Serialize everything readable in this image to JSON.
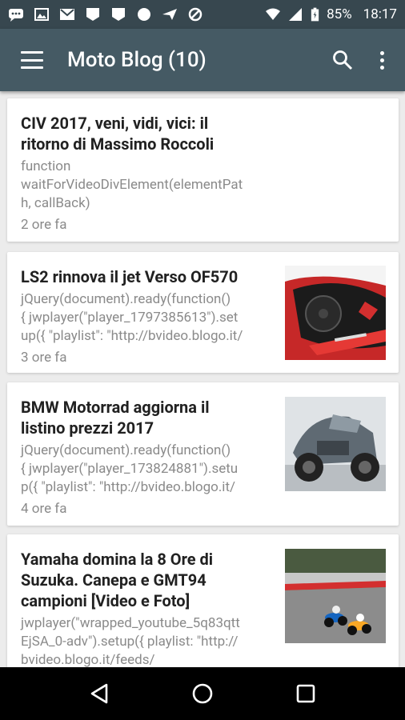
{
  "status_bar": {
    "battery": "85%",
    "time": "18:17",
    "left_icons": [
      "chat-icon",
      "image-icon",
      "gmail-icon",
      "shield-icon",
      "shield-icon",
      "circle-icon",
      "send-icon",
      "blocked-icon"
    ],
    "right_icons": [
      "wifi-icon",
      "signal-icon",
      "battery-icon"
    ]
  },
  "app_bar": {
    "title": "Moto Blog (10)",
    "menu_icon": "hamburger-menu-icon",
    "search_icon": "search-icon",
    "more_icon": "more-vert-icon"
  },
  "posts": [
    {
      "title_l1": "CIV 2017, veni, vidi, vici: il",
      "title_l2": "ritorno di Massimo Roccoli",
      "snippet_l1": "function",
      "snippet_l2": "waitForVideoDivElement(elementPat",
      "snippet_l3": "h, callBack)",
      "time": "2 ore fa",
      "has_thumb": false
    },
    {
      "title_l1": "LS2 rinnova il jet Verso OF570",
      "snippet_l1": "jQuery(document).ready(function()",
      "snippet_l2": "{ jwplayer(\"player_1797385613\").set",
      "snippet_l3": "up({ \"playlist\": \"http://bvideo.blogo.it/",
      "time": "3 ore fa",
      "thumb": "helmet-photo"
    },
    {
      "title_l1": "BMW Motorrad aggiorna il",
      "title_l2": "listino prezzi 2017",
      "snippet_l1": "jQuery(document).ready(function()",
      "snippet_l2": "{ jwplayer(\"player_173824881\").setu",
      "snippet_l3": "p({ \"playlist\": \"http://bvideo.blogo.it/",
      "time": "4 ore fa",
      "thumb": "bmw-motorcycle-photo"
    },
    {
      "title_l1": "Yamaha domina la 8 Ore di",
      "title_l2": "Suzuka. Canepa e GMT94",
      "title_l3": "campioni [Video e Foto]",
      "snippet_l1": "jwplayer(\"wrapped_youtube_5q83qtt",
      "snippet_l2": "EjSA_0-adv\").setup({ playlist: \"http://",
      "snippet_l3": "bvideo.blogo.it/feeds/",
      "thumb": "race-photo"
    }
  ],
  "nav_bar": {
    "back_icon": "back-triangle-icon",
    "home_icon": "home-circle-icon",
    "recents_icon": "recents-square-icon"
  },
  "colors": {
    "status_bar": "#37474f",
    "app_bar": "#455a64",
    "background": "#ececec"
  }
}
